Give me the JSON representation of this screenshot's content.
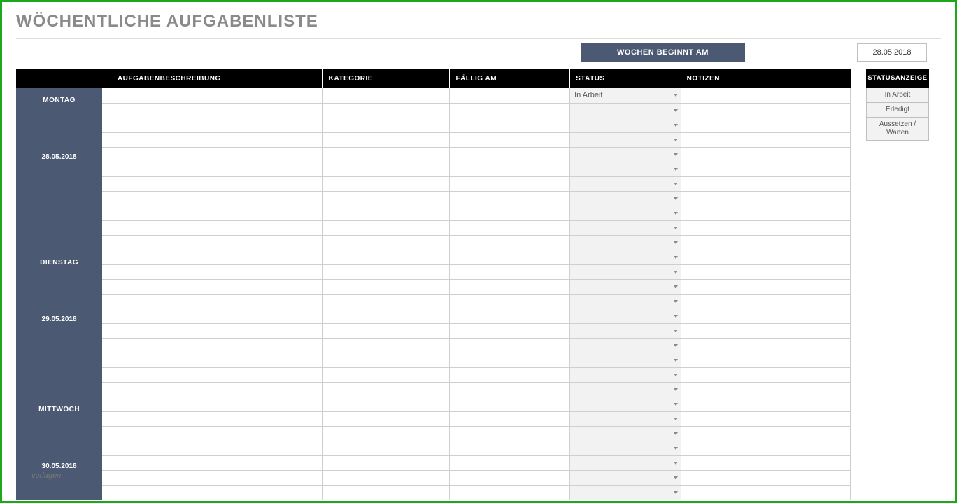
{
  "title": "WÖCHENTLICHE AUFGABENLISTE",
  "week": {
    "label": "WOCHEN BEGINNT AM",
    "date": "28.05.2018"
  },
  "columns": {
    "day": "",
    "desc": "AUFGABENBESCHREIBUNG",
    "cat": "KATEGORIE",
    "due": "FÄLLIG AM",
    "status": "STATUS",
    "notes": "NOTIZEN"
  },
  "days": [
    {
      "name": "MONTAG",
      "date": "28.05.2018",
      "rows": 11,
      "status_first": "In Arbeit"
    },
    {
      "name": "DIENSTAG",
      "date": "29.05.2018",
      "rows": 10,
      "status_first": ""
    },
    {
      "name": "MITTWOCH",
      "date": "30.05.2018",
      "rows": 7,
      "status_first": ""
    }
  ],
  "legend": {
    "header": "STATUSANZEIGE",
    "items": [
      "In Arbeit",
      "Erledigt",
      "Aussetzen / Warten"
    ]
  },
  "watermark": "vorlagen"
}
